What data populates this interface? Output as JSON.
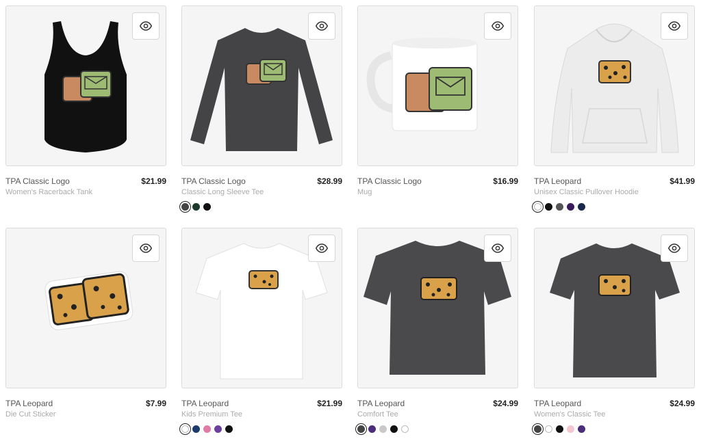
{
  "products": [
    {
      "title": "TPA Classic Logo",
      "subtitle": "Women's Racerback Tank",
      "price": "$21.99",
      "swatches": []
    },
    {
      "title": "TPA Classic Logo",
      "subtitle": "Classic Long Sleeve Tee",
      "price": "$28.99",
      "swatches": [
        "#444444",
        "#1c3a2c",
        "#111111"
      ]
    },
    {
      "title": "TPA Classic Logo",
      "subtitle": "Mug",
      "price": "$16.99",
      "swatches": []
    },
    {
      "title": "TPA Leopard",
      "subtitle": "Unisex Classic Pullover Hoodie",
      "price": "$41.99",
      "swatches": [
        "#ffffff",
        "#111111",
        "#555555",
        "#3a1c5c",
        "#1b2a4a"
      ]
    },
    {
      "title": "TPA Leopard",
      "subtitle": "Die Cut Sticker",
      "price": "$7.99",
      "swatches": []
    },
    {
      "title": "TPA Leopard",
      "subtitle": "Kids Premium Tee",
      "price": "$21.99",
      "swatches": [
        "#ffffff",
        "#1c3a6c",
        "#e07ba6",
        "#6b3fa0",
        "#111111"
      ]
    },
    {
      "title": "TPA Leopard",
      "subtitle": "Comfort Tee",
      "price": "$24.99",
      "swatches": [
        "#444444",
        "#4b2d7a",
        "#c8c8c8",
        "#111111",
        "#ffffff"
      ]
    },
    {
      "title": "TPA Leopard",
      "subtitle": "Women's Classic Tee",
      "price": "$24.99",
      "swatches": [
        "#444444",
        "#ffffff",
        "#111111",
        "#f4c6cf",
        "#4b2d7a"
      ]
    }
  ],
  "icons": {
    "quick_view": "eye-icon"
  },
  "colors": {
    "leopard": "#d9a24a",
    "classic_green": "#9dbb73",
    "classic_tan": "#c98a62",
    "dark_shirt": "#4a4a4c"
  }
}
